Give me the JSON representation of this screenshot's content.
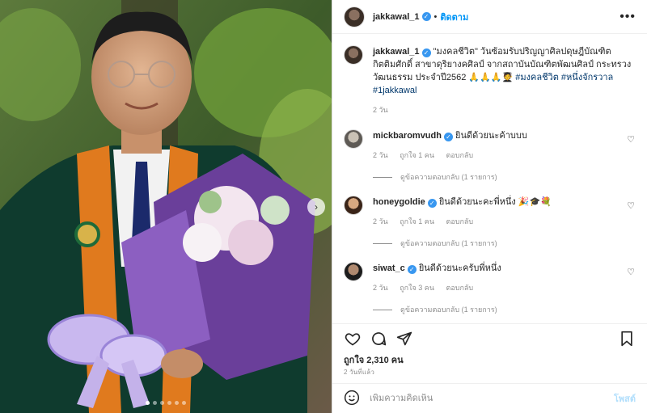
{
  "header": {
    "username": "jakkawal_1",
    "separator": "•",
    "follow_label": "ติดตาม",
    "more_icon": "more-horizontal-icon"
  },
  "caption": {
    "username": "jakkawal_1",
    "text": "\"มงคลชีวิต\" วันซ้อมรับปริญญาศิลปดุษฎีบัณฑิตกิตติมศักดิ์ สาขาดุริยางคศิลป์ จากสถาบันบัณฑิตพัฒนศิลป์ กระทรวงวัฒนธรรม ประจำปี2562 🙏🙏🙏🧑‍🎓",
    "hashtags": "#มงคลชีวิต #หนึ่งจักรวาล #1jakkawal",
    "time": "2 วัน"
  },
  "comments": [
    {
      "username": "mickbaromvudh",
      "text": "ยินดีด้วยนะค้าบบบ",
      "time": "2 วัน",
      "likes": "ถูกใจ 1 คน",
      "reply_label": "ตอบกลับ",
      "view_replies": "ดูข้อความตอบกลับ (1 รายการ)"
    },
    {
      "username": "honeygoldie",
      "text": "ยินดีด้วยนะคะพี่หนึ่ง 🎉🎓💐",
      "time": "2 วัน",
      "likes": "ถูกใจ 1 คน",
      "reply_label": "ตอบกลับ",
      "view_replies": "ดูข้อความตอบกลับ (1 รายการ)"
    },
    {
      "username": "siwat_c",
      "text": "ยินดีด้วยนะครับพี่หนึ่ง",
      "time": "2 วัน",
      "likes": "ถูกใจ 3 คน",
      "reply_label": "ตอบกลับ",
      "view_replies": "ดูข้อความตอบกลับ (1 รายการ)"
    }
  ],
  "actions": {
    "like_icon": "heart-icon",
    "comment_icon": "comment-icon",
    "share_icon": "share-icon",
    "save_icon": "bookmark-icon"
  },
  "likes_text": "ถูกใจ 2,310 คน",
  "posted_time": "2 วันที่แล้ว",
  "add_comment": {
    "placeholder": "เพิ่มความคิดเห็น",
    "post_label": "โพสต์",
    "emoji_icon": "emoji-icon"
  },
  "carousel": {
    "slide_count": 6,
    "active_index": 0
  },
  "colors": {
    "accent": "#0095f6",
    "verified": "#3897f0",
    "post_disabled": "#b2dffc",
    "muted": "#8e8e8e"
  }
}
